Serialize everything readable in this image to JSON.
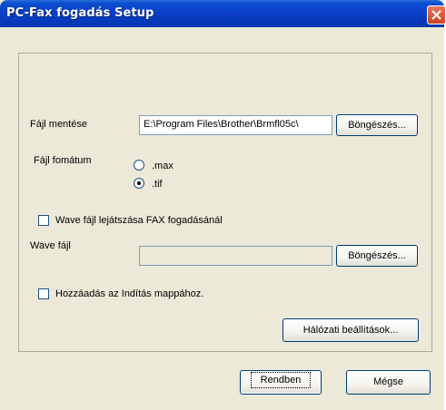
{
  "window": {
    "title": "PC-Fax fogadás Setup"
  },
  "form": {
    "save_file_label": "Fájl mentése",
    "save_file_path": "E:\\Program Files\\Brother\\Brmfl05c\\",
    "browse_label": "Böngészés...",
    "file_format_label": "Fájl fomátum",
    "format_options": [
      ".max",
      ".tif"
    ],
    "selected_format": ".tif",
    "wave_play_label": "Wave fájl lejátszása FAX fogadásánál",
    "wave_play_checked": false,
    "wave_file_label": "Wave fájl",
    "wave_file_value": "",
    "wave_browse_label": "Böngészés...",
    "startup_label": "Hozzáadás az Indítás mappához.",
    "startup_checked": false,
    "network_settings_label": "Hálózati beállítások..."
  },
  "footer": {
    "ok_label": "Rendben",
    "cancel_label": "Mégse"
  }
}
